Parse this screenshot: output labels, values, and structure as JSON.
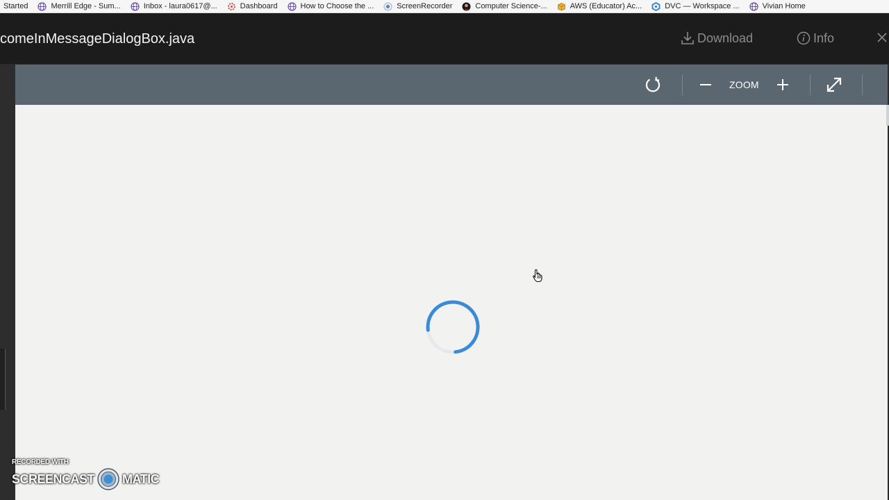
{
  "bookmarks": [
    {
      "label": "Started",
      "icon": "none"
    },
    {
      "label": "Merrill Edge - Sum...",
      "icon": "globe-icon"
    },
    {
      "label": "Inbox - laura0617@...",
      "icon": "globe-icon"
    },
    {
      "label": "Dashboard",
      "icon": "canvas-icon"
    },
    {
      "label": "How to Choose the ...",
      "icon": "globe-icon"
    },
    {
      "label": "ScreenRecorder",
      "icon": "record-icon"
    },
    {
      "label": "Computer Science-...",
      "icon": "avatar-icon"
    },
    {
      "label": "AWS (Educator) Ac...",
      "icon": "box-icon"
    },
    {
      "label": "DVC — Workspace ...",
      "icon": "hex-icon"
    },
    {
      "label": "Vivian Home",
      "icon": "globe-icon"
    }
  ],
  "viewer": {
    "file_title": "comeInMessageDialogBox.java",
    "download_label": "Download",
    "info_label": "Info"
  },
  "toolbar": {
    "zoom_label": "ZOOM"
  },
  "watermark": {
    "small": "RECORDED WITH",
    "left": "SCREENCAST",
    "right": "MATIC"
  },
  "colors": {
    "toolbar_bg": "#5b6770",
    "header_bg": "#1c1c1c",
    "doc_bg": "#f2f2f1",
    "spinner": "#3a8ad8"
  }
}
